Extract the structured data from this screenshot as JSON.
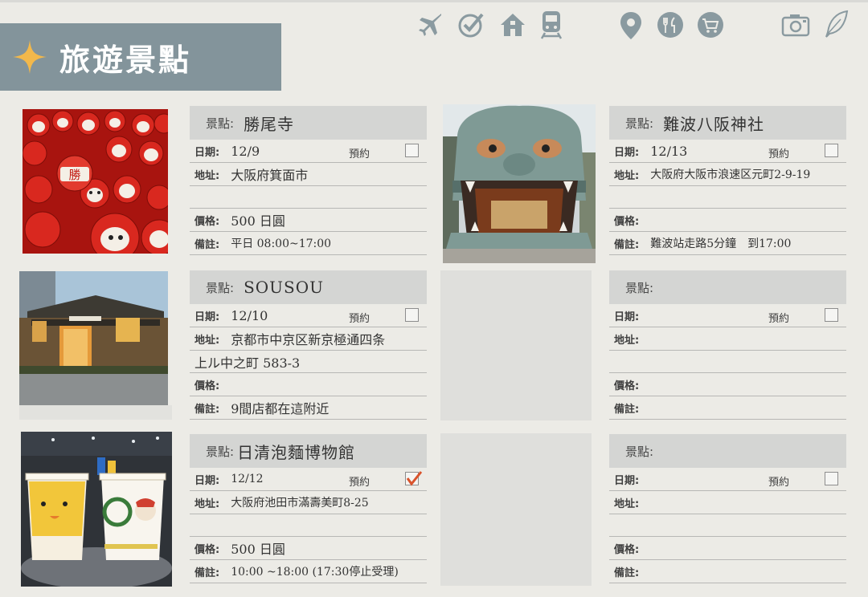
{
  "page": {
    "title": "旅遊景點",
    "accent_color": "#83949b",
    "check_color": "#d9532c"
  },
  "toolbar": {
    "icons": [
      "airplane-icon",
      "checkmark-icon",
      "home-icon",
      "train-icon",
      "location-pin-icon",
      "restaurant-icon",
      "shopping-cart-icon",
      "camera-icon",
      "feather-icon"
    ]
  },
  "labels": {
    "name": "景點:",
    "date": "日期:",
    "reserve": "預約",
    "address": "地址:",
    "price": "價格:",
    "note": "備註:"
  },
  "cards": [
    {
      "name": "勝尾寺",
      "date": "12/9",
      "reserved": false,
      "address": "大阪府箕面市",
      "address2": "",
      "price": "500 日圓",
      "note": "平日 08:00~17:00"
    },
    {
      "name": "難波八阪神社",
      "date": "12/13",
      "reserved": false,
      "address": "大阪府大阪市浪速区元町2-9-19",
      "address2": "",
      "price": "",
      "note": "難波站走路5分鐘　到17:00"
    },
    {
      "name": "SOUSOU",
      "date": "12/10",
      "reserved": false,
      "address": "京都市中京区新京極通四条",
      "address2": "上ル中之町 583-3",
      "price": "",
      "note": "9間店都在這附近"
    },
    {
      "name": "",
      "date": "",
      "reserved": false,
      "address": "",
      "address2": "",
      "price": "",
      "note": ""
    },
    {
      "name": "日清泡麵博物館",
      "date": "12/12",
      "reserved": true,
      "address": "大阪府池田市滿壽美町8-25",
      "address2": "",
      "price": "500 日圓",
      "note": "10:00 ~18:00 (17:30停止受理)"
    },
    {
      "name": "",
      "date": "",
      "reserved": false,
      "address": "",
      "address2": "",
      "price": "",
      "note": ""
    }
  ],
  "photos": [
    {
      "name": "daruma-photo",
      "color": "#c8261f"
    },
    {
      "name": "namba-yasaka-shrine-photo",
      "color": "#6f8a86"
    },
    {
      "name": "sousou-store-photo",
      "color": "#6b5234"
    },
    {
      "name": "cup-noodles-photo",
      "color": "#f3c43c"
    }
  ]
}
